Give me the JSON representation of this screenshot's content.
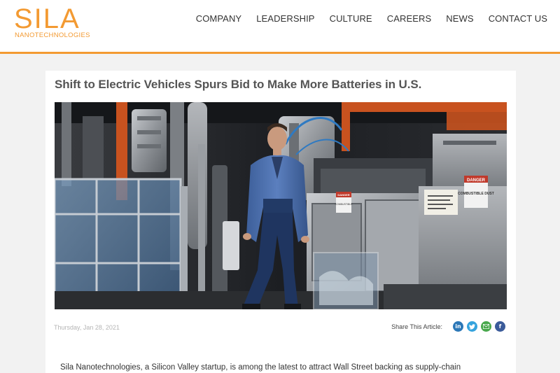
{
  "logo": {
    "wordmark": "SILA",
    "subtitle": "NANOTECHNOLOGIES",
    "brand_color": "#f39a32"
  },
  "nav": {
    "items": [
      {
        "label": "COMPANY"
      },
      {
        "label": "LEADERSHIP"
      },
      {
        "label": "CULTURE"
      },
      {
        "label": "CAREERS"
      },
      {
        "label": "NEWS"
      },
      {
        "label": "CONTACT US"
      }
    ]
  },
  "article": {
    "title": "Shift to Electric Vehicles Spurs Bid to Make More Batteries in U.S.",
    "date": "Thursday, Jan 28, 2021",
    "share_label": "Share This Article:",
    "share_icons": [
      "linkedin-icon",
      "twitter-icon",
      "email-icon",
      "facebook-icon"
    ],
    "lead": "Sila Nanotechnologies, a Silicon Valley startup, is among the latest to attract Wall Street backing as supply-chain"
  },
  "photo_signs": {
    "danger_1": "DANGER",
    "combustible_1": "COMBUSTIBLE",
    "danger_2": "DANGER",
    "combustible_2": "COMBUSTIBLE DUST"
  }
}
